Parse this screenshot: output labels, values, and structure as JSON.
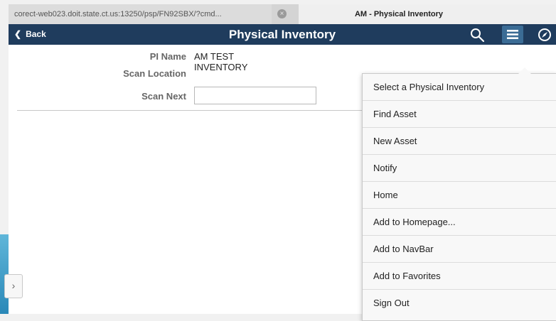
{
  "browser": {
    "url_tab": "corect-web023.doit.state.ct.us:13250/psp/FN92SBX/?cmd...",
    "active_tab": "AM - Physical Inventory"
  },
  "header": {
    "back_label": "Back",
    "title": "Physical Inventory"
  },
  "form": {
    "pi_name_label": "PI Name",
    "pi_name_value": "AM TEST INVENTORY",
    "scan_location_label": "Scan Location",
    "scan_next_label": "Scan Next",
    "scan_next_value": ""
  },
  "menu": {
    "items": [
      "Select a Physical Inventory",
      "Find Asset",
      "New Asset",
      "Notify",
      "Home",
      "Add to Homepage...",
      "Add to NavBar",
      "Add to Favorites",
      "Sign Out"
    ]
  },
  "colors": {
    "header_bg": "#1f3c5d",
    "menu_active_bg": "#3b6c95"
  },
  "icons": [
    "close-tab-icon",
    "back-chevron-icon",
    "search-icon",
    "hamburger-menu-icon",
    "navbar-compass-icon",
    "expand-chevron-icon"
  ]
}
